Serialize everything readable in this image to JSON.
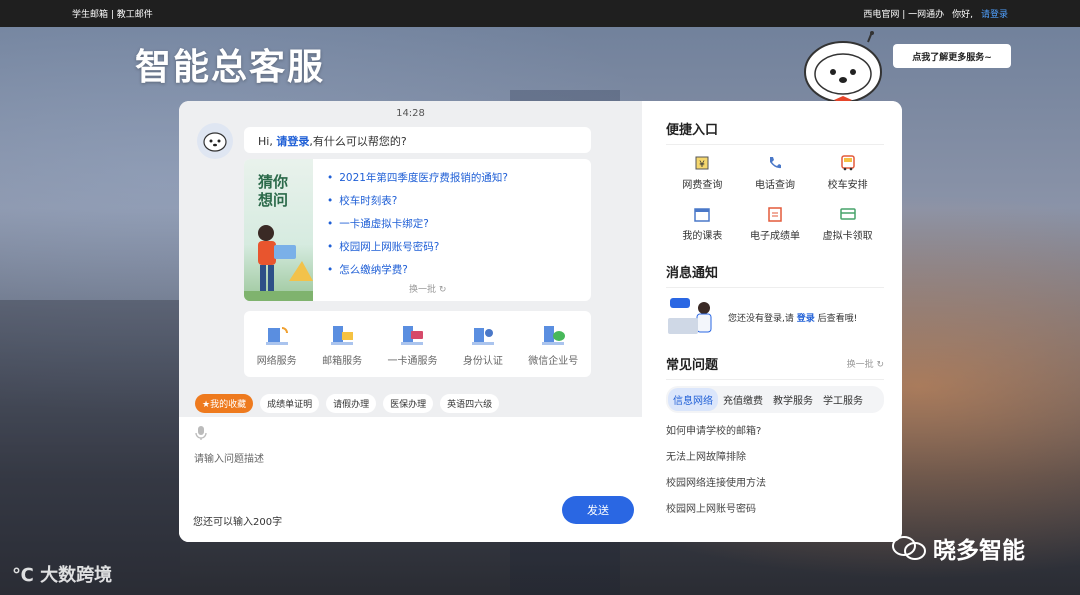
{
  "topbar": {
    "left": "学生邮箱 | 教工邮件",
    "site": "西电官网 | 一网通办",
    "hello": "你好,",
    "login": "请登录"
  },
  "header": {
    "logo": "智能总客服",
    "more_button": "点我了解更多服务~"
  },
  "chat": {
    "time": "14:28",
    "greeting_prefix": "Hi,",
    "greeting_login": "请登录",
    "greeting_suffix": ",有什么可以帮您的?",
    "guess_title": "猜你想问",
    "guess_items": [
      "2021年第四季度医疗费报销的通知?",
      "校车时刻表?",
      "一卡通虚拟卡绑定?",
      "校园网上网账号密码?",
      "怎么缴纳学费?"
    ],
    "refresh": "换一批",
    "services": [
      "网络服务",
      "邮箱服务",
      "一卡通服务",
      "身份认证",
      "微信企业号"
    ],
    "tags": [
      "★我的收藏",
      "成绩单证明",
      "请假办理",
      "医保办理",
      "英语四六级"
    ],
    "input_placeholder": "请输入问题描述",
    "remaining": "您还可以输入200字",
    "send": "发送"
  },
  "side": {
    "quick_title": "便捷入口",
    "quick_items": [
      "网费查询",
      "电话查询",
      "校车安排",
      "我的课表",
      "电子成绩单",
      "虚拟卡领取"
    ],
    "notice_title": "消息通知",
    "notice_prefix": "您还没有登录,请",
    "notice_login": "登录",
    "notice_suffix": "后查看哦!",
    "faq_title": "常见问题",
    "faq_refresh": "换一批",
    "faq_tabs": [
      "信息网络",
      "充值缴费",
      "教学服务",
      "学工服务"
    ],
    "faq_items": [
      "如何申请学校的邮箱?",
      "无法上网故障排除",
      "校园网络连接使用方法",
      "校园网上网账号密码"
    ]
  },
  "watermarks": {
    "left": "大数跨境",
    "right": "晓多智能"
  },
  "colors": {
    "accent": "#2a67e3",
    "orange": "#ee7a1e",
    "link": "#1f5fd6"
  }
}
